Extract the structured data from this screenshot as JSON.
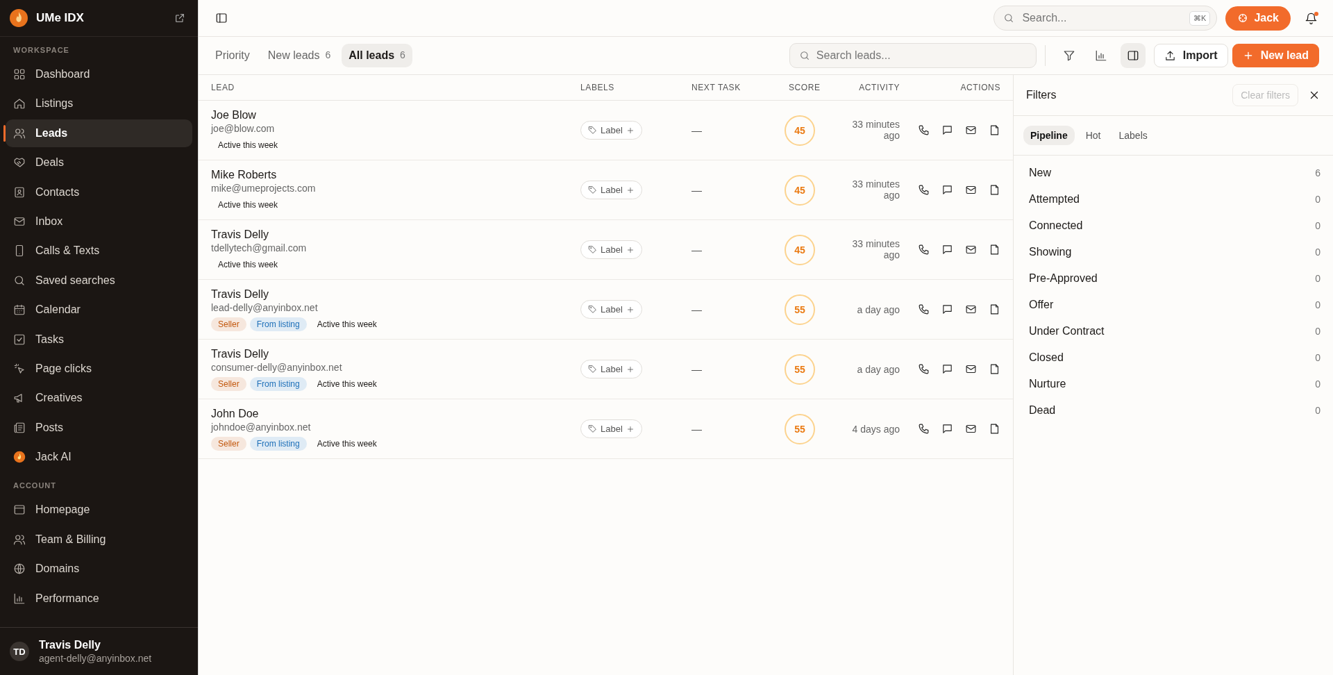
{
  "brand": {
    "name": "UMe IDX"
  },
  "sidebar": {
    "sections": [
      {
        "title": "WORKSPACE",
        "items": [
          {
            "label": "Dashboard",
            "selected": false
          },
          {
            "label": "Listings",
            "selected": false
          },
          {
            "label": "Leads",
            "selected": true
          },
          {
            "label": "Deals",
            "selected": false
          },
          {
            "label": "Contacts",
            "selected": false
          },
          {
            "label": "Inbox",
            "selected": false
          },
          {
            "label": "Calls & Texts",
            "selected": false
          },
          {
            "label": "Saved searches",
            "selected": false
          },
          {
            "label": "Calendar",
            "selected": false
          },
          {
            "label": "Tasks",
            "selected": false
          },
          {
            "label": "Page clicks",
            "selected": false
          },
          {
            "label": "Creatives",
            "selected": false
          },
          {
            "label": "Posts",
            "selected": false
          },
          {
            "label": "Jack AI",
            "selected": false
          }
        ]
      },
      {
        "title": "ACCOUNT",
        "items": [
          {
            "label": "Homepage",
            "selected": false
          },
          {
            "label": "Team & Billing",
            "selected": false
          },
          {
            "label": "Domains",
            "selected": false
          },
          {
            "label": "Performance",
            "selected": false
          }
        ]
      }
    ],
    "user": {
      "initials": "TD",
      "name": "Travis Delly",
      "email": "agent-delly@anyinbox.net"
    }
  },
  "topbar": {
    "search": {
      "placeholder": "Search...",
      "shortcut": "⌘K"
    },
    "assistant_button": "Jack",
    "notification_dot": true
  },
  "tabs": [
    {
      "label": "Priority",
      "selected": false
    },
    {
      "label": "New leads",
      "count": "6",
      "selected": false
    },
    {
      "label": "All leads",
      "count": "6",
      "selected": true
    }
  ],
  "toolbar": {
    "search": {
      "placeholder": "Search leads..."
    },
    "panel_toggle_on": true,
    "import_button": "Import",
    "new_button": "New lead"
  },
  "table": {
    "columns": [
      "LEAD",
      "LABELS",
      "NEXT TASK",
      "SCORE",
      "ACTIVITY",
      "ACTIONS"
    ],
    "rows": [
      {
        "name": "Joe Blow",
        "email": "joe@blow.com",
        "tags": [
          {
            "text": "Active this week"
          }
        ],
        "label_button": "Label",
        "next_task": "—",
        "score": "45",
        "activity": "33 minutes ago"
      },
      {
        "name": "Mike Roberts",
        "email": "mike@umeprojects.com",
        "tags": [
          {
            "text": "Active this week"
          }
        ],
        "label_button": "Label",
        "next_task": "—",
        "score": "45",
        "activity": "33 minutes ago"
      },
      {
        "name": "Travis Delly",
        "email": "tdellytech@gmail.com",
        "tags": [
          {
            "text": "Active this week"
          }
        ],
        "label_button": "Label",
        "next_task": "—",
        "score": "45",
        "activity": "33 minutes ago"
      },
      {
        "name": "Travis Delly",
        "email": "lead-delly@anyinbox.net",
        "tags": [
          {
            "text": "Seller",
            "color": "#c2570c"
          },
          {
            "text": "From listing",
            "color": "#1d6fb8"
          },
          {
            "text": "Active this week"
          }
        ],
        "label_button": "Label",
        "next_task": "—",
        "score": "55",
        "activity": "a day ago"
      },
      {
        "name": "Travis Delly",
        "email": "consumer-delly@anyinbox.net",
        "tags": [
          {
            "text": "Seller",
            "color": "#c2570c"
          },
          {
            "text": "From listing",
            "color": "#1d6fb8"
          },
          {
            "text": "Active this week"
          }
        ],
        "label_button": "Label",
        "next_task": "—",
        "score": "55",
        "activity": "a day ago"
      },
      {
        "name": "John Doe",
        "email": "johndoe@anyinbox.net",
        "tags": [
          {
            "text": "Seller",
            "color": "#c2570c"
          },
          {
            "text": "From listing",
            "color": "#1d6fb8"
          },
          {
            "text": "Active this week"
          }
        ],
        "label_button": "Label",
        "next_task": "—",
        "score": "55",
        "activity": "4 days ago"
      }
    ]
  },
  "filters": {
    "title": "Filters",
    "clear_button": {
      "label": "Clear filters",
      "disabled": true
    },
    "tabs": [
      {
        "label": "Pipeline",
        "selected": true
      },
      {
        "label": "Hot",
        "selected": false
      },
      {
        "label": "Labels",
        "selected": false
      }
    ],
    "stages": [
      {
        "label": "New",
        "count": "6"
      },
      {
        "label": "Attempted",
        "count": "0"
      },
      {
        "label": "Connected",
        "count": "0"
      },
      {
        "label": "Showing",
        "count": "0"
      },
      {
        "label": "Pre-Approved",
        "count": "0"
      },
      {
        "label": "Offer",
        "count": "0"
      },
      {
        "label": "Under Contract",
        "count": "0"
      },
      {
        "label": "Closed",
        "count": "0"
      },
      {
        "label": "Nurture",
        "count": "0"
      },
      {
        "label": "Dead",
        "count": "0"
      }
    ]
  }
}
